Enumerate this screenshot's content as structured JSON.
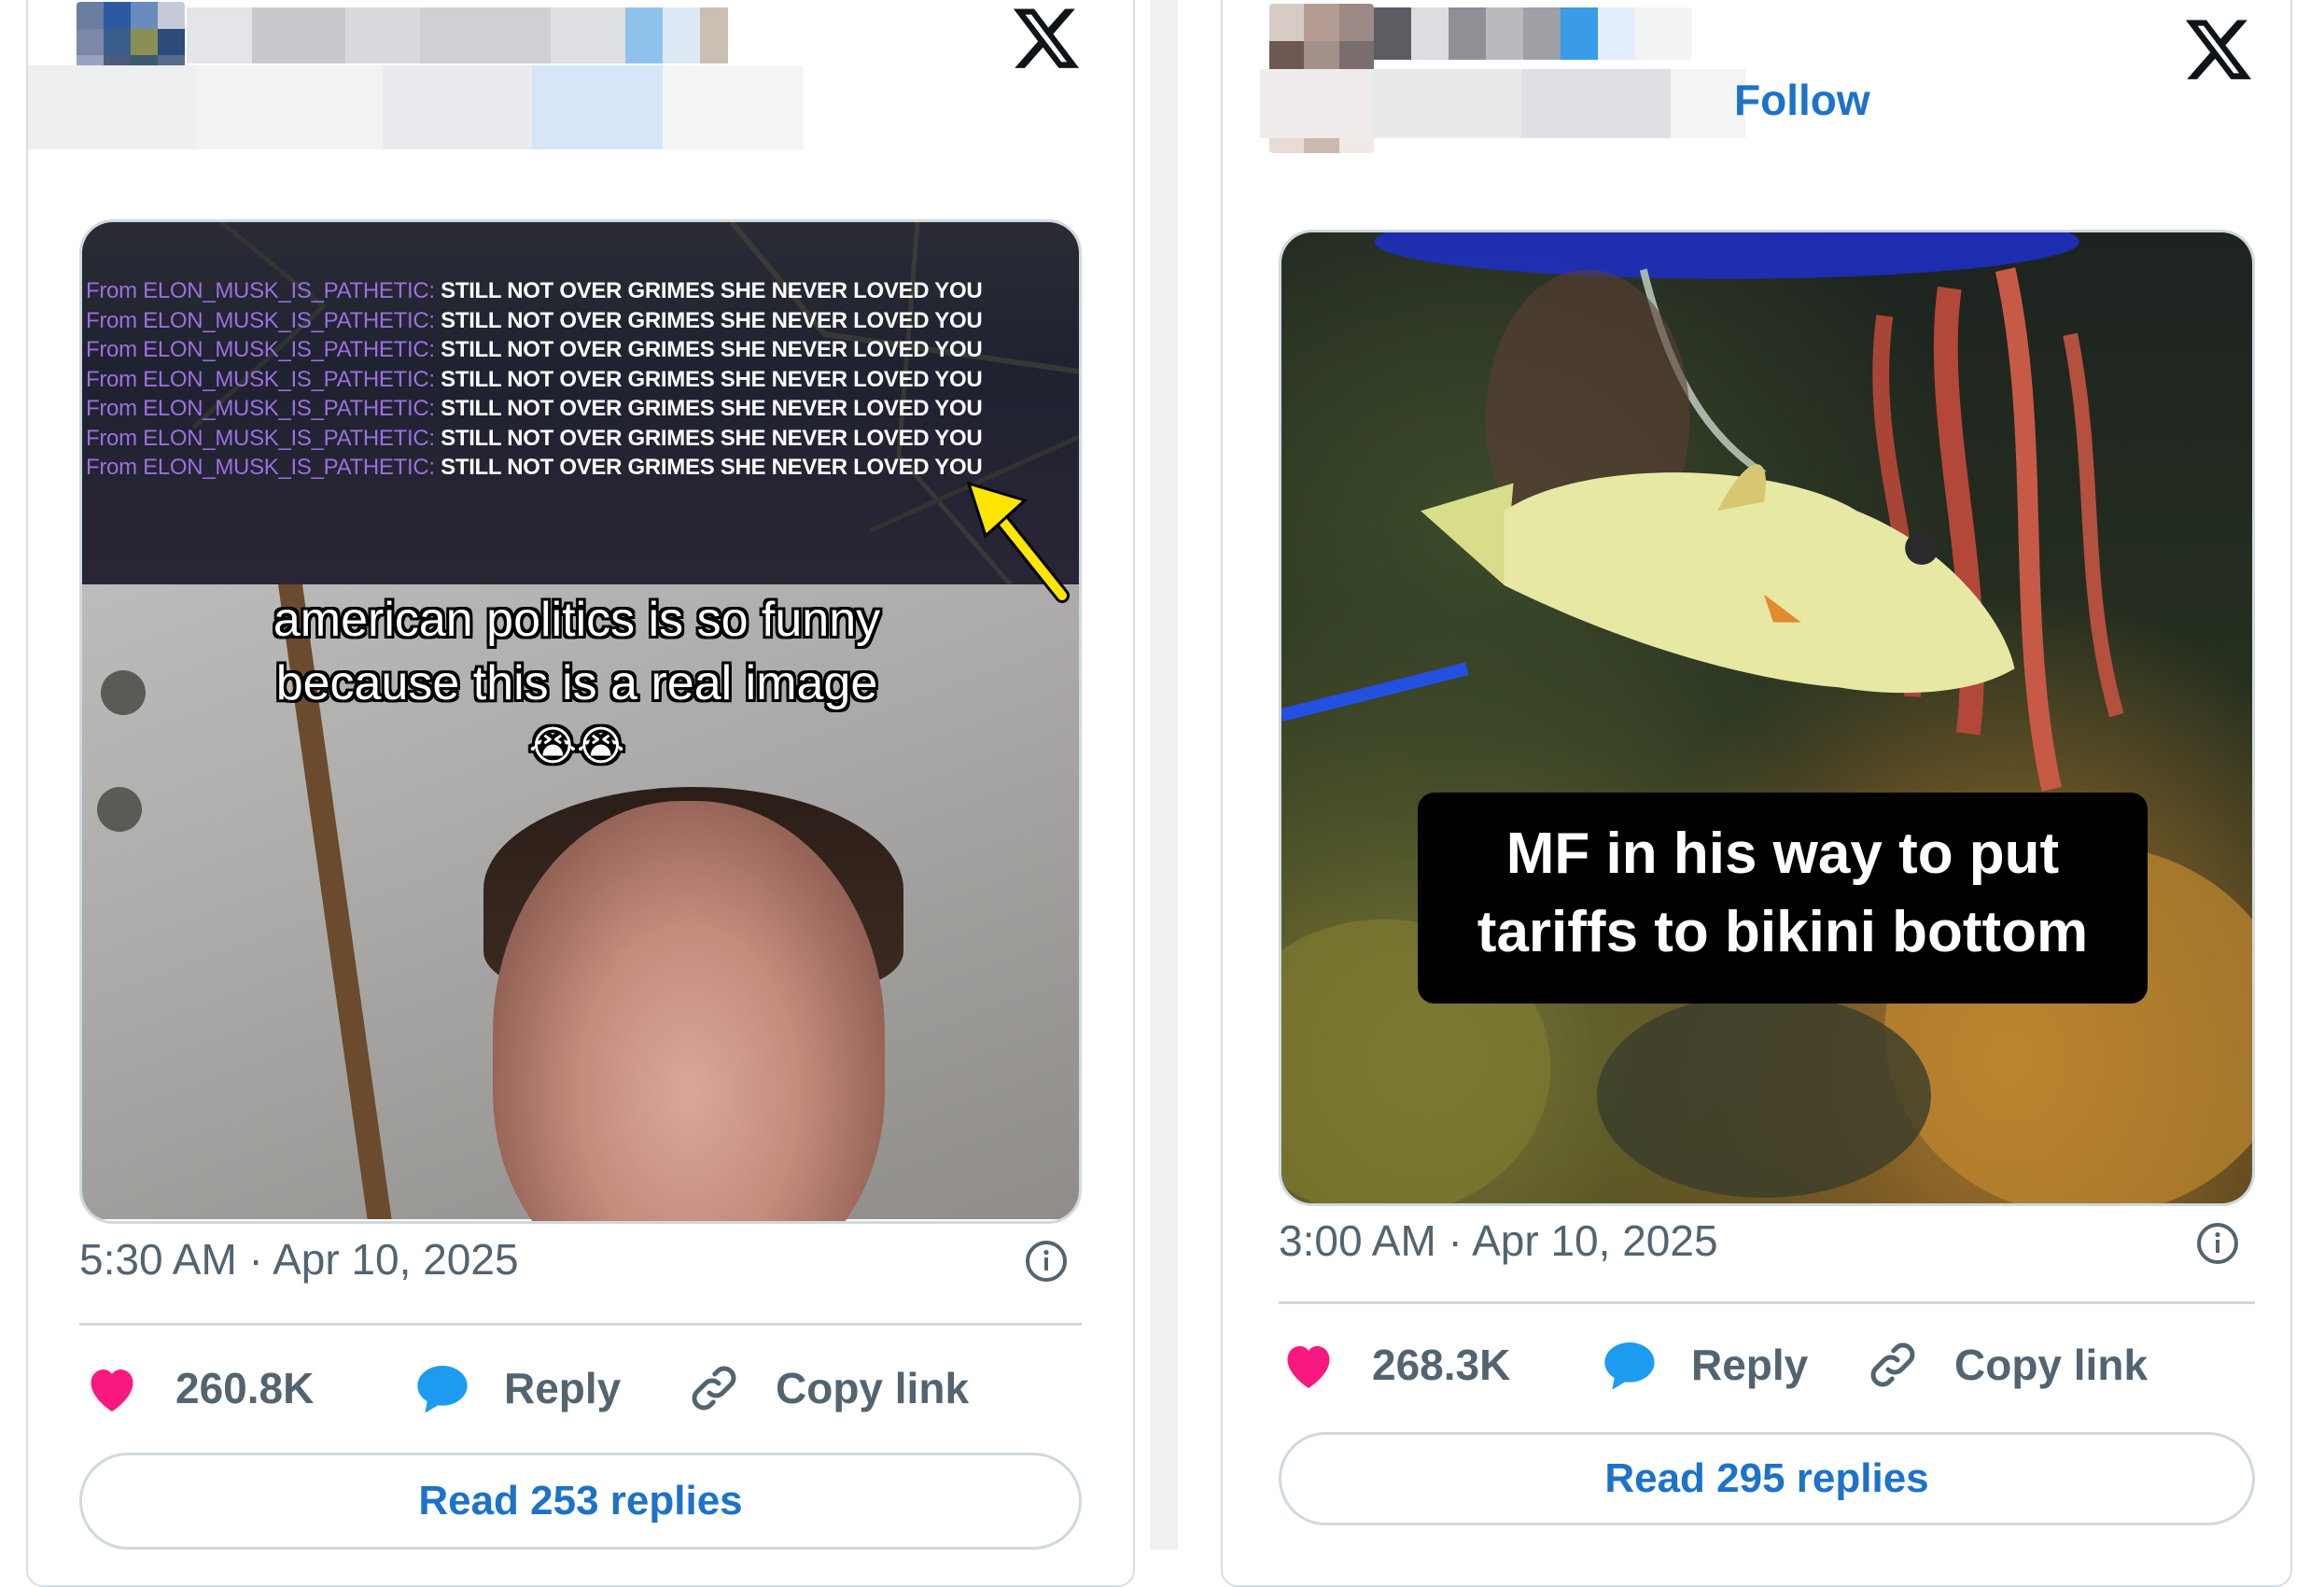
{
  "left_tweet": {
    "spam_line": {
      "from": "From ELON_MUSK_IS_PATHETIC:",
      "message": "STILL NOT OVER GRIMES SHE NEVER LOVED YOU"
    },
    "spam_repeat": 7,
    "caption_line1": "american politics is so funny",
    "caption_line2": "because this is a real image",
    "caption_emoji": "😭😭",
    "timestamp": "5:30 AM · Apr 10, 2025",
    "likes": "260.8K",
    "reply_label": "Reply",
    "copy_link_label": "Copy link",
    "read_replies": "Read 253 replies"
  },
  "right_tweet": {
    "follow_label": "Follow",
    "caption_line1": "MF in his way to put",
    "caption_line2": "tariffs to bikini bottom",
    "timestamp": "3:00 AM · Apr 10, 2025",
    "likes": "268.3K",
    "reply_label": "Reply",
    "copy_link_label": "Copy link",
    "read_replies": "Read 295 replies"
  },
  "colors": {
    "link_blue": "#1d72c9",
    "like_pink": "#f91880",
    "reply_blue": "#1d9bf0",
    "muted_text": "#536471",
    "border": "#cfd9de",
    "arrow_yellow": "#ffe600"
  },
  "icons": [
    "x-logo-icon",
    "info-icon",
    "heart-icon",
    "speech-bubble-icon",
    "link-icon",
    "arrow-icon"
  ]
}
